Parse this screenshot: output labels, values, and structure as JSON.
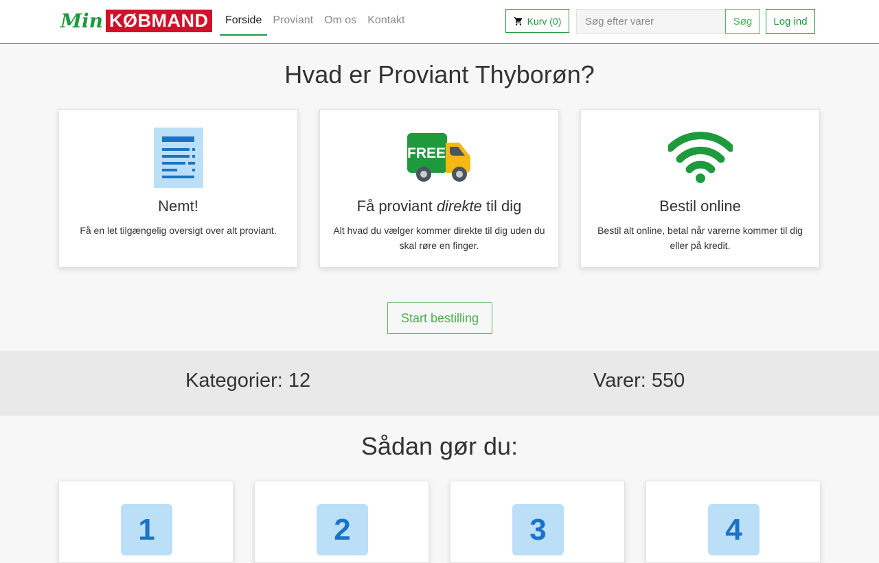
{
  "header": {
    "logo_prefix": "Min",
    "logo_brand": "KØBMAND",
    "nav": [
      {
        "label": "Forside",
        "active": true
      },
      {
        "label": "Proviant",
        "active": false
      },
      {
        "label": "Om os",
        "active": false
      },
      {
        "label": "Kontakt",
        "active": false
      }
    ],
    "cart_label": "Kurv (0)",
    "search_placeholder": "Søg efter varer",
    "search_value": "",
    "search_button": "Søg",
    "login_button": "Log ind"
  },
  "intro": {
    "title": "Hvad er Proviant Thyborøn?",
    "features": [
      {
        "icon": "document-icon",
        "title": "Nemt!",
        "text": "Få en let tilgængelig oversigt over alt proviant."
      },
      {
        "icon": "free-delivery-truck-icon",
        "title_pre": "Få proviant ",
        "title_em": "direkte",
        "title_post": " til dig",
        "badge_text": "FREE",
        "text": "Alt hvad du vælger kommer direkte til dig uden du skal røre en finger."
      },
      {
        "icon": "wifi-icon",
        "title": "Bestil online",
        "text": "Bestil alt online, betal når varerne kommer til dig eller på kredit."
      }
    ],
    "start_button": "Start bestilling"
  },
  "stats": {
    "categories_label": "Kategorier:",
    "categories_value": "12",
    "items_label": "Varer:",
    "items_value": "550"
  },
  "howto": {
    "title": "Sådan gør du:",
    "steps": [
      "1",
      "2",
      "3",
      "4"
    ]
  },
  "colors": {
    "brand_green": "#1e9a3d",
    "brand_red": "#d2102a",
    "step_badge": "#bcdff8",
    "step_number": "#1a73c8"
  }
}
